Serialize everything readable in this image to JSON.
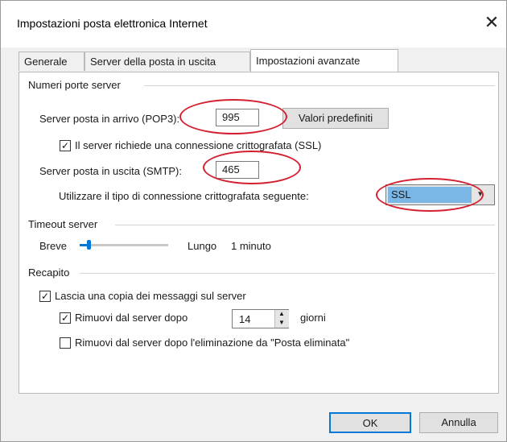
{
  "window": {
    "title": "Impostazioni posta elettronica Internet",
    "close_glyph": "✕"
  },
  "tabs": [
    {
      "label": "Generale"
    },
    {
      "label": "Server della posta in uscita"
    },
    {
      "label": "Impostazioni avanzate",
      "active": true
    }
  ],
  "ports": {
    "section_label": "Numeri porte server",
    "incoming_label": "Server posta in arrivo (POP3):",
    "incoming_value": "995",
    "defaults_button": "Valori predefiniti",
    "ssl_checkbox_label": "Il server richiede una connessione crittografata (SSL)",
    "ssl_checked": true,
    "outgoing_label": "Server posta in uscita (SMTP):",
    "outgoing_value": "465",
    "encryption_label": "Utilizzare il tipo di connessione crittografata seguente:",
    "encryption_value": "SSL"
  },
  "timeout": {
    "section_label": "Timeout server",
    "short_label": "Breve",
    "long_label": "Lungo",
    "value_text": "1 minuto",
    "slider_level": 0.1
  },
  "delivery": {
    "section_label": "Recapito",
    "keep_copy_label": "Lascia una copia dei messaggi sul server",
    "keep_copy_checked": true,
    "remove_after_label": "Rimuovi dal server dopo",
    "remove_after_checked": true,
    "remove_after_days": "14",
    "days_label": "giorni",
    "remove_deleted_label": "Rimuovi dal server dopo l'eliminazione da \"Posta eliminata\"",
    "remove_deleted_checked": false
  },
  "footer": {
    "ok_label": "OK",
    "cancel_label": "Annulla"
  },
  "annotation_color": "#d42030"
}
